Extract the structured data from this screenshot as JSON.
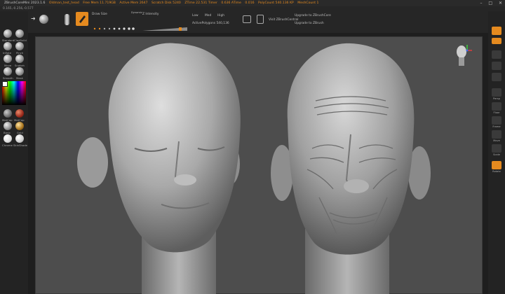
{
  "title_bar": {
    "app": "ZBrushCoreMini 2023.1.6",
    "items": [
      "Oldman_test_head",
      "Free Mem 11.719GB",
      "Active Mem 2647",
      "Scratch Disk 5240",
      "ZTime 22.531 Timer",
      "0.636 ATime",
      "0.016",
      "PolyCount 540.136 KP",
      "MeshCount 1"
    ]
  },
  "coords": "0.165,-0.256,-0.577",
  "toolbar": {
    "draw_size_label": "Draw Size",
    "dynamic_label": "Dynamic",
    "z_intensity_label": "Z Intensity",
    "levels": [
      "Low",
      "Med",
      "High"
    ],
    "active_polys": "ActivePolygons 540,136",
    "visit": "Visit ZBrushCentral",
    "upgrade_core": "Upgrade to ZBrushCore",
    "upgrade_zbrush": "Upgrade to ZBrush"
  },
  "left_brushes": [
    {
      "label": "Standard"
    },
    {
      "label": "ClayBuild"
    },
    {
      "label": "Inflate"
    },
    {
      "label": "Pinch"
    },
    {
      "label": "Move"
    },
    {
      "label": "Snakeh"
    },
    {
      "label": "Smooth"
    },
    {
      "label": "Mask"
    }
  ],
  "left_materials": [
    {
      "label": "MatCap"
    },
    {
      "label": "MatCap"
    },
    {
      "label": "Basic"
    },
    {
      "label": "Gold"
    },
    {
      "label": "Chrome"
    },
    {
      "label": "SkinShade"
    }
  ],
  "right_buttons": [
    {
      "label": "Persp"
    },
    {
      "label": "Floor"
    },
    {
      "label": "Frame"
    },
    {
      "label": "Move"
    },
    {
      "label": "Scale"
    },
    {
      "label": "Rotate"
    }
  ],
  "colors": {
    "accent": "#e58a1f",
    "viewport": "#4d4d4d"
  }
}
